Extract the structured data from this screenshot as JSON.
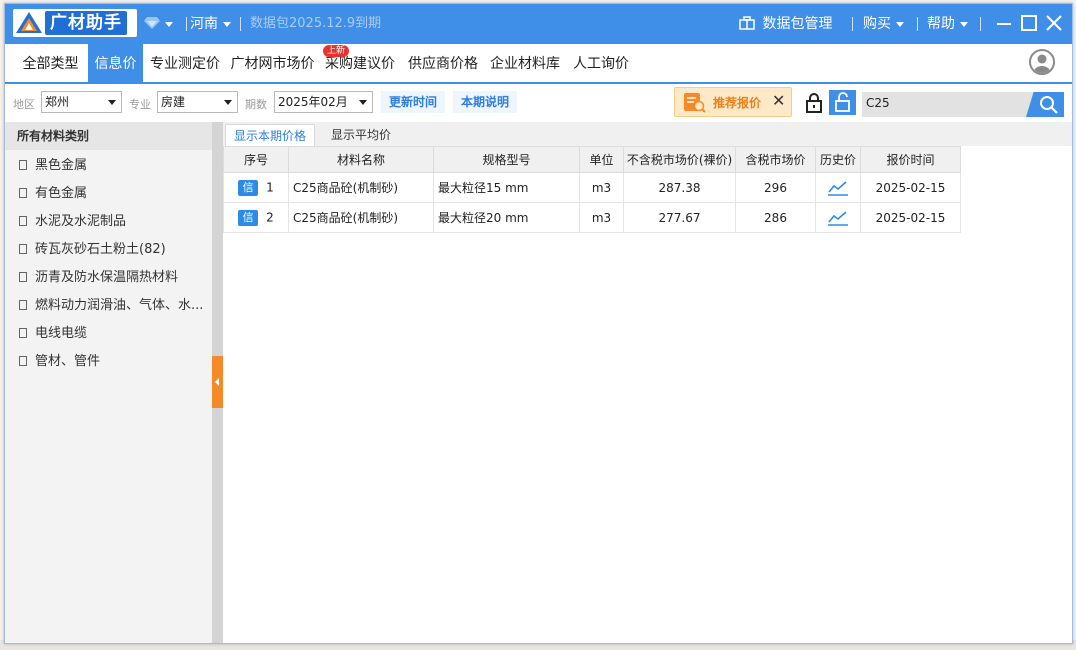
{
  "app": {
    "logo_text": "广材助手",
    "region": "河南",
    "package_expiry": "数据包2025.12.9到期",
    "menu": {
      "package_manage": "数据包管理",
      "buy": "购买",
      "help": "帮助"
    }
  },
  "tabs": [
    {
      "label": "全部类型"
    },
    {
      "label": "信息价",
      "active": true
    },
    {
      "label": "专业测定价"
    },
    {
      "label": "广材网市场价"
    },
    {
      "label": "采购建议价",
      "badge": "上新"
    },
    {
      "label": "供应商价格"
    },
    {
      "label": "企业材料库"
    },
    {
      "label": "人工询价"
    }
  ],
  "filters": {
    "region_label": "地区",
    "region_value": "郑州",
    "specialty_label": "专业",
    "specialty_value": "房建",
    "period_label": "期数",
    "period_value": "2025年02月",
    "update_time_button": "更新时间",
    "period_note_button": "本期说明",
    "recommend_quote": "推荐报价",
    "search_value": "C25"
  },
  "sidebar": {
    "header": "所有材料类别",
    "items": [
      {
        "label": "黑色金属"
      },
      {
        "label": "有色金属"
      },
      {
        "label": "水泥及水泥制品"
      },
      {
        "label": "砖瓦灰砂石土粉土(82)"
      },
      {
        "label": "沥青及防水保温隔热材料"
      },
      {
        "label": "燃料动力润滑油、气体、水..."
      },
      {
        "label": "电线电缆"
      },
      {
        "label": "管材、管件"
      }
    ]
  },
  "subtabs": {
    "current": "显示本期价格",
    "average": "显示平均价"
  },
  "table": {
    "columns": [
      "序号",
      "材料名称",
      "规格型号",
      "单位",
      "不含税市场价(裸价)",
      "含税市场价",
      "历史价",
      "报价时间"
    ],
    "tag": "信",
    "rows": [
      {
        "no": "1",
        "name": "C25商品砼(机制砂)",
        "spec": "最大粒径15 mm",
        "unit": "m3",
        "price_ex_tax": "287.38",
        "price_tax": "296",
        "date": "2025-02-15"
      },
      {
        "no": "2",
        "name": "C25商品砼(机制砂)",
        "spec": "最大粒径20 mm",
        "unit": "m3",
        "price_ex_tax": "277.67",
        "price_tax": "286",
        "date": "2025-02-15"
      }
    ]
  },
  "colors": {
    "accent": "#3f8ee8",
    "orange": "#f58a28",
    "badge": "#e8322d"
  }
}
